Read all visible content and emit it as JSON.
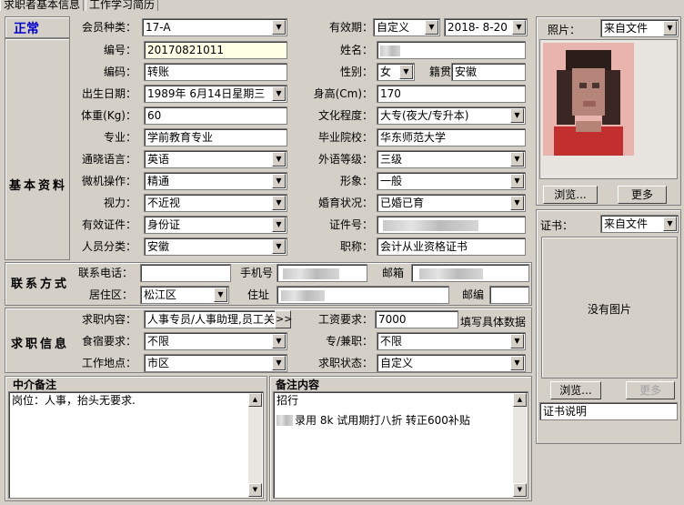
{
  "tabs": [
    "求职者基本信息",
    "工作学习简历"
  ],
  "status": "正常",
  "sections": {
    "basic": "基本资料",
    "contact": "联系方式",
    "job": "求职信息"
  },
  "member": {
    "type_label": "会员种类：",
    "type": "17-A",
    "valid_label": "有效期：",
    "valid_mode": "自定义",
    "valid_date": "2018- 8-20"
  },
  "basic": {
    "id_label": "编号：",
    "id": "20170821011",
    "name_label": "姓名：",
    "code_label": "编码：",
    "code": "转账",
    "gender_label": "性别：",
    "gender": "女",
    "native_label": "籍贯",
    "native": "安徽",
    "birth_label": "出生日期：",
    "birth": "1989年 6月14日星期三",
    "height_label": "身高(Cm)：",
    "height": "170",
    "weight_label": "体重(Kg)：",
    "weight": "60",
    "edu_label": "文化程度：",
    "edu": "大专(夜大/专升本)",
    "major_label": "专业：",
    "major": "学前教育专业",
    "school_label": "毕业院校：",
    "school": "华东师范大学",
    "lang_label": "通晓语言：",
    "lang": "英语",
    "flang_label": "外语等级：",
    "flang": "三级",
    "pc_label": "微机操作：",
    "pc": "精通",
    "look_label": "形象：",
    "look": "一般",
    "vision_label": "视力：",
    "vision": "不近视",
    "marry_label": "婚育状况：",
    "marry": "已婚已育",
    "cert_label": "有效证件：",
    "cert": "身份证",
    "certno_label": "证件号：",
    "cat_label": "人员分类：",
    "cat": "安徽",
    "title_label": "职称：",
    "title": "会计从业资格证书"
  },
  "contact": {
    "phone_label": "联系电话：",
    "mobile_label": "手机号",
    "email_label": "邮箱",
    "area_label": "居住区：",
    "area": "松江区",
    "addr_label": "住址",
    "zip_label": "邮编"
  },
  "job": {
    "want_label": "求职内容：",
    "want": "人事专员/人事助理,员工关系",
    "more": ">>",
    "salary_label": "工资要求：",
    "salary": "7000",
    "salary_hint": "填写具体数据",
    "board_label": "食宿要求：",
    "board": "不限",
    "ptype_label": "专/兼职：",
    "ptype": "不限",
    "place_label": "工作地点：",
    "place": "市区",
    "state_label": "求职状态：",
    "state": "自定义"
  },
  "photo": {
    "label": "照片：",
    "source": "来自文件",
    "browse": "浏览...",
    "more": "更多"
  },
  "cert": {
    "label": "证书：",
    "source": "来自文件",
    "none": "没有图片",
    "browse": "浏览...",
    "more": "更多",
    "desc": "证书说明"
  },
  "memo1": {
    "title": "中介备注",
    "text": "岗位：人事，抬头无要求."
  },
  "memo2": {
    "title": "备注内容",
    "line1": "招行",
    "line2": "录用 8k 试用期打八折 转正600补贴"
  }
}
